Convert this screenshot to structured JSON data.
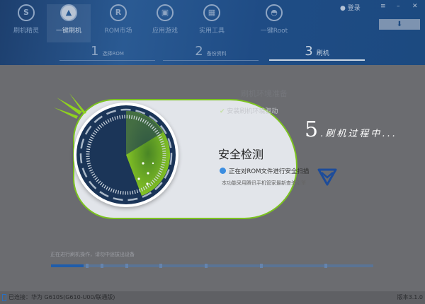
{
  "nav": [
    {
      "label": "刷机精灵",
      "icon": "shield-s-icon"
    },
    {
      "label": "一键刷机",
      "icon": "cursor-icon"
    },
    {
      "label": "ROM市场",
      "icon": "r-icon"
    },
    {
      "label": "应用游戏",
      "icon": "bag-icon"
    },
    {
      "label": "实用工具",
      "icon": "grid-icon"
    },
    {
      "label": "一键Root",
      "icon": "android-icon"
    }
  ],
  "top_right": {
    "login": "登录"
  },
  "steps": [
    {
      "num": "1",
      "label": "选择ROM"
    },
    {
      "num": "2",
      "label": "备份资料"
    },
    {
      "num": "3",
      "label": "刷机"
    }
  ],
  "card": {
    "ghost_title": "刷机环境准备",
    "ghost_item": "安装刷机环境驱动",
    "title": "安全检测",
    "scan_text": "正在对ROM文件进行安全扫描",
    "engine_text": "本功能采用腾讯手机管家最新查杀引擎"
  },
  "overlay": {
    "step_num": "5",
    "step_text": ".刷机过程中..."
  },
  "progress": {
    "text": "正在进行刷机操作，请勿中途拔出设备",
    "value": 0.1
  },
  "status": {
    "connected": "已连接：华为 G610S(G610-U00/联通版)",
    "version": "版本3.1.0"
  },
  "colors": {
    "accent": "#7bc31f",
    "header": "#1c4a80",
    "progress": "#1f5dab"
  }
}
